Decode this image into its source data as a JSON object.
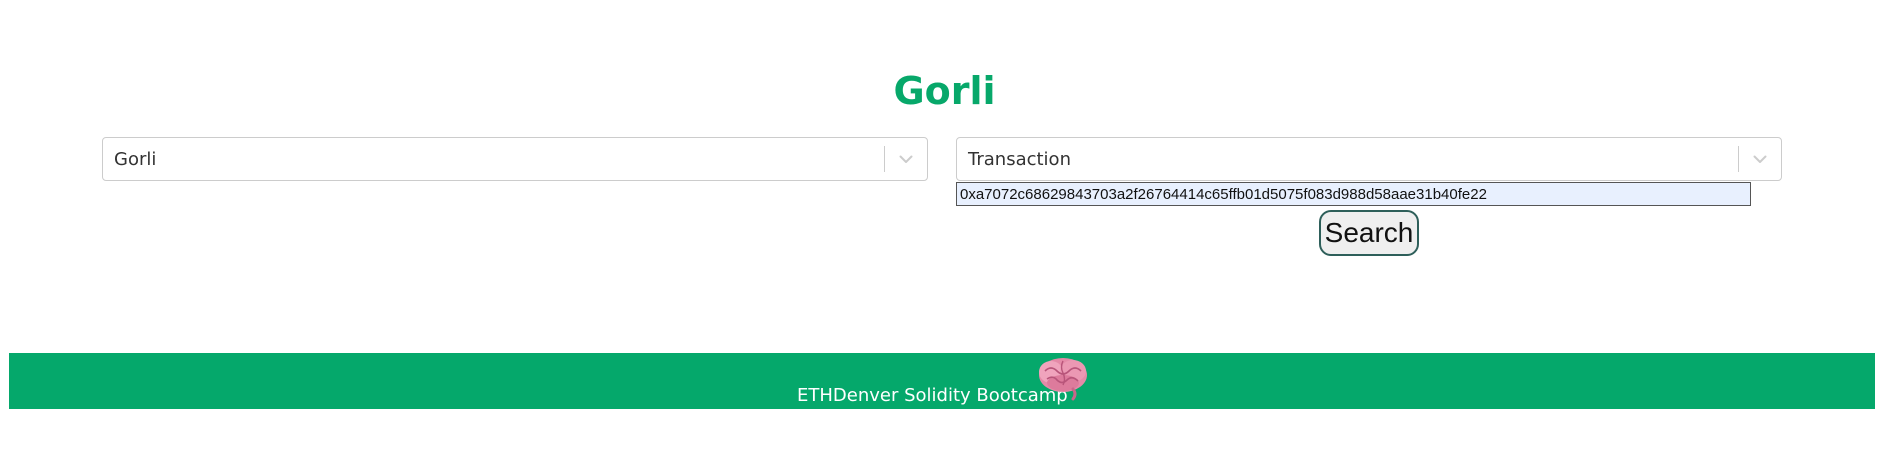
{
  "header": {
    "title": "Gorli"
  },
  "network_select": {
    "value": "Gorli",
    "indicator_icon": "chevron-down-icon"
  },
  "type_select": {
    "value": "Transaction",
    "indicator_icon": "chevron-down-icon"
  },
  "search": {
    "input_value": "0xa7072c68629843703a2f26764414c65ffb01d5075f083d988d58aae31b40fe22",
    "button_label": "Search"
  },
  "footer": {
    "text": "ETHDenver Solidity Bootcamp",
    "icon": "brain-icon"
  },
  "colors": {
    "brand_green": "#07a86a",
    "footer_green": "#05a86b",
    "input_autofill": "#e8f0fe"
  }
}
